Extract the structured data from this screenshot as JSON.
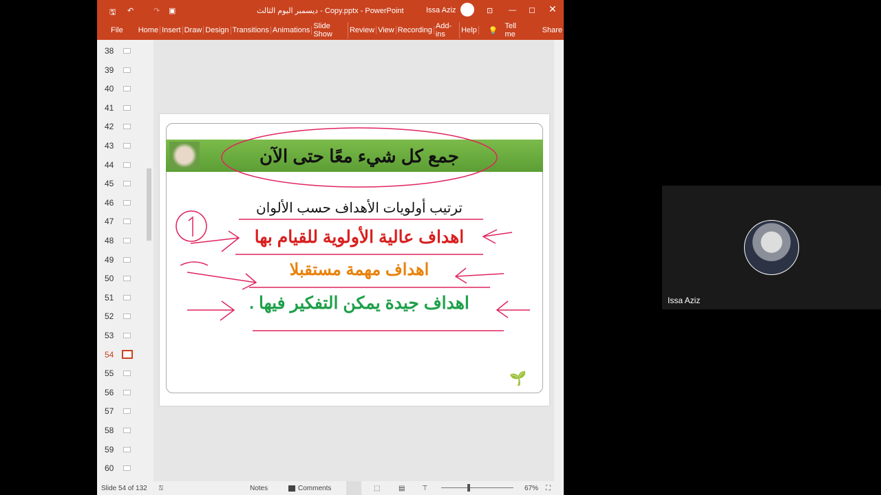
{
  "window": {
    "title": "ديسمبر اليوم الثالث - Copy.pptx - PowerPoint",
    "user": "Issa Aziz",
    "accent": "#c9431f"
  },
  "ribbon": {
    "tabs": [
      "File",
      "Home",
      "Insert",
      "Draw",
      "Design",
      "Transitions",
      "Animations",
      "Slide Show",
      "Review",
      "View",
      "Recording",
      "Add-ins",
      "Help"
    ],
    "tell_me": "Tell me",
    "share": "Share"
  },
  "thumbnails": [
    "38",
    "39",
    "40",
    "41",
    "42",
    "43",
    "44",
    "45",
    "46",
    "47",
    "48",
    "49",
    "50",
    "51",
    "52",
    "53",
    "54",
    "55",
    "56",
    "57",
    "58",
    "59",
    "60"
  ],
  "selected_slide": "54",
  "slide": {
    "title": "جمع كل شيء معًا حتى الآن",
    "subtitle": "ترتيب أولويات الأهداف حسب الألوان",
    "line1": "اهداف عالية الأولوية للقيام بها",
    "line2": "اهداف مهمة مستقبلا",
    "line3": "اهداف جيدة يمكن التفكير فيها .",
    "colors": {
      "line1": "#d91e1e",
      "line2": "#e8820c",
      "line3": "#1ea04a",
      "ink": "#e0245e"
    }
  },
  "status": {
    "slide_info": "Slide 54 of 132",
    "notes": "Notes",
    "comments": "Comments",
    "zoom": "67%"
  },
  "video": {
    "name": "Issa Aziz"
  }
}
